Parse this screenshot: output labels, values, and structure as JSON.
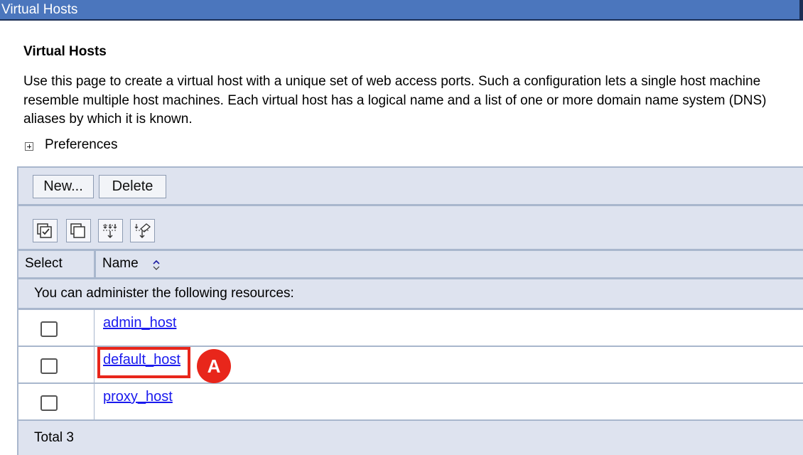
{
  "window": {
    "title": "Virtual Hosts"
  },
  "page": {
    "heading": "Virtual Hosts",
    "description": "Use this page to create a virtual host with a unique set of web access ports. Such a configuration lets a single host machine resemble multiple host machines. Each virtual host has a logical name and a list of one or more domain name system (DNS) aliases by which it is known.",
    "preferences_label": "Preferences"
  },
  "toolbar": {
    "new_label": "New...",
    "delete_label": "Delete",
    "icons": [
      "select-all-icon",
      "deselect-all-icon",
      "show-filter-icon",
      "clear-filter-icon"
    ]
  },
  "table": {
    "columns": [
      "Select",
      "Name"
    ],
    "info_text": "You can administer the following resources:",
    "rows": [
      {
        "name": "admin_host",
        "selected": false
      },
      {
        "name": "default_host",
        "selected": false
      },
      {
        "name": "proxy_host",
        "selected": false
      }
    ],
    "total_text": "Total 3"
  },
  "annotation": {
    "label": "A",
    "color": "#e8261b"
  },
  "colors": {
    "titlebar": "#4b76bd",
    "panel": "#dee3ef",
    "link": "#1a1aee"
  }
}
